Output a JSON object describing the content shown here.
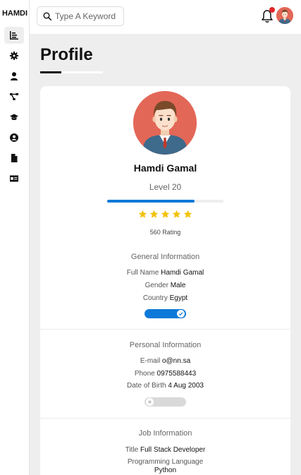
{
  "sidebar": {
    "brand": "HAMDI",
    "items": [
      {
        "icon": "dashboard-icon",
        "active": true
      },
      {
        "icon": "settings-icon",
        "active": false
      },
      {
        "icon": "user-icon",
        "active": false
      },
      {
        "icon": "projects-icon",
        "active": false
      },
      {
        "icon": "courses-icon",
        "active": false
      },
      {
        "icon": "friends-icon",
        "active": false
      },
      {
        "icon": "files-icon",
        "active": false
      },
      {
        "icon": "plans-icon",
        "active": false
      }
    ]
  },
  "header": {
    "search_placeholder": "Type A Keyword",
    "has_notification": true
  },
  "page": {
    "title": "Profile"
  },
  "profile": {
    "name": "Hamdi Gamal",
    "level": "Level 20",
    "progress": 0.75,
    "stars": 5,
    "rating": "560 Rating"
  },
  "general": {
    "title": "General Information",
    "full_name_label": "Full Name",
    "full_name": "Hamdi Gamal",
    "gender_label": "Gender",
    "gender": "Male",
    "country_label": "Country",
    "country": "Egypt",
    "toggle_on": true
  },
  "personal": {
    "title": "Personal Information",
    "email_label": "E-mail",
    "email": "o@nn.sa",
    "phone_label": "Phone",
    "phone": "0975588443",
    "dob_label": "Date of Birth",
    "dob": "4 Aug 2003",
    "toggle_on": false
  },
  "job": {
    "title": "Job Information",
    "title_label": "Title",
    "job_title": "Full Stack Developer",
    "language_label": "Programming Language",
    "language": "Python"
  },
  "colors": {
    "accent": "#0d79d8",
    "star": "#f4c20d",
    "notification": "#e0262a",
    "avatar_bg": "#e36757"
  }
}
